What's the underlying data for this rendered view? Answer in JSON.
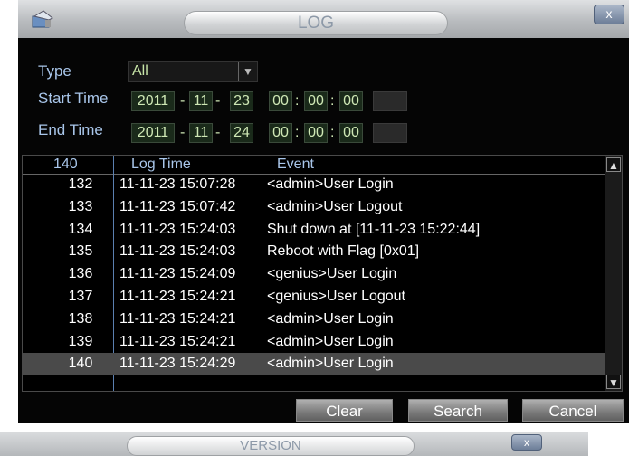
{
  "window": {
    "title": "LOG",
    "close_label": "x"
  },
  "filters": {
    "type_label": "Type",
    "type_value": "All",
    "start_label": "Start Time",
    "start": {
      "year": "2011",
      "month": "11",
      "day": "23",
      "hour": "00",
      "minute": "00",
      "second": "00"
    },
    "end_label": "End Time",
    "end": {
      "year": "2011",
      "month": "11",
      "day": "24",
      "hour": "00",
      "minute": "00",
      "second": "00"
    },
    "date_sep": "-",
    "time_sep": ":"
  },
  "table": {
    "headers": {
      "count": "140",
      "time": "Log Time",
      "event": "Event"
    },
    "rows": [
      {
        "no": "132",
        "time": "11-11-23 15:07:28",
        "event": "<admin>User Login"
      },
      {
        "no": "133",
        "time": "11-11-23 15:07:42",
        "event": "<admin>User Logout"
      },
      {
        "no": "134",
        "time": "11-11-23 15:24:03",
        "event": "Shut down at [11-11-23 15:22:44]"
      },
      {
        "no": "135",
        "time": "11-11-23 15:24:03",
        "event": "Reboot with Flag [0x01]"
      },
      {
        "no": "136",
        "time": "11-11-23 15:24:09",
        "event": "<genius>User Login"
      },
      {
        "no": "137",
        "time": "11-11-23 15:24:21",
        "event": "<genius>User Logout"
      },
      {
        "no": "138",
        "time": "11-11-23 15:24:21",
        "event": "<admin>User Login"
      },
      {
        "no": "139",
        "time": "11-11-23 15:24:21",
        "event": "<admin>User Login"
      },
      {
        "no": "140",
        "time": "11-11-23 15:24:29",
        "event": "<admin>User Login"
      }
    ],
    "selected_row": "140"
  },
  "buttons": {
    "clear": "Clear",
    "search": "Search",
    "cancel": "Cancel"
  },
  "background_window": {
    "title": "VERSION",
    "close_label": "x"
  }
}
